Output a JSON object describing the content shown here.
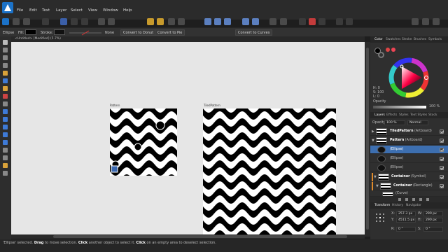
{
  "menu": [
    "File",
    "Edit",
    "Text",
    "Layer",
    "Select",
    "View",
    "Window",
    "Help"
  ],
  "context": {
    "tool": "Ellipse",
    "fill_label": "Fill:",
    "stroke_label": "Stroke:",
    "stroke_value": "None",
    "convert_donut": "Convert to Donut",
    "convert_pie": "Convert to Pie",
    "convert_curves": "Convert to Curves"
  },
  "document": {
    "tab_title": "<Untitled> [Modified] (5.7%)"
  },
  "artboards": [
    {
      "label": "Pattern"
    },
    {
      "label": "TiledPattern"
    }
  ],
  "panel": {
    "tabs_top": [
      "Color",
      "Swatches",
      "Stroke",
      "Brushes",
      "Symbols"
    ],
    "hsl_h": "H: 0",
    "hsl_s": "S: 100",
    "hsl_l": "L: 0",
    "opacity_label": "Opacity",
    "opacity_value": "100 %",
    "tabs_mid": [
      "Layers",
      "Effects",
      "Styles",
      "Text Styles",
      "Stock"
    ],
    "layers_opacity_label": "Opacity:",
    "layers_opacity_value": "100 %",
    "blend_mode": "Normal",
    "layers": [
      {
        "name": "TiledPattern",
        "type": "(Artboard)"
      },
      {
        "name": "Pattern",
        "type": "(Artboard)"
      },
      {
        "name": "",
        "type": "(Ellipse)"
      },
      {
        "name": "",
        "type": "(Ellipse)"
      },
      {
        "name": "",
        "type": "(Ellipse)"
      },
      {
        "name": "Container",
        "type": "(Symbol)"
      },
      {
        "name": "Container",
        "type": "(Rectangle)"
      },
      {
        "name": "",
        "type": "(Curve)"
      }
    ],
    "tabs_bottom": [
      "Transform",
      "History",
      "Navigator"
    ],
    "transform": {
      "x_label": "X:",
      "x_value": "257.3 px",
      "y_label": "Y:",
      "y_value": "4511.5 px",
      "w_label": "W:",
      "w_value": "290 px",
      "h_label": "H:",
      "h_value": "290 px",
      "r_label": "R:",
      "r_value": "0 °",
      "s_label": "S:",
      "s_value": "0 °"
    }
  },
  "status": {
    "prefix": "'Ellipse' selected.",
    "k1": "Drag",
    "t1": "to move selection.",
    "k2": "Click",
    "t2": "another object to select it.",
    "k3": "Click",
    "t3": "on an empty area to deselect selection."
  },
  "colors": {
    "accent": "#3d6fb0",
    "fill_swatch": "#000000",
    "canvas_bg": "#e6e6e6"
  }
}
